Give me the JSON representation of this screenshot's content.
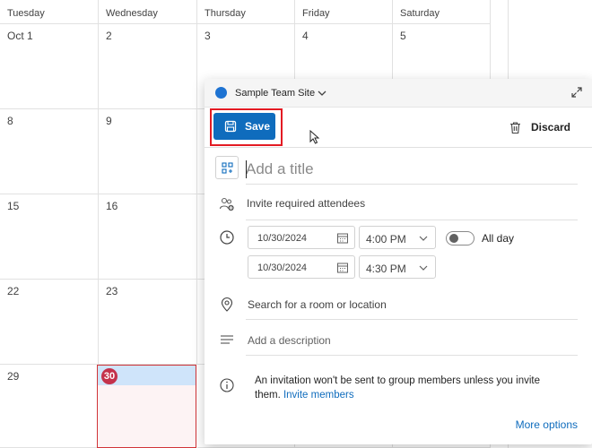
{
  "calendar": {
    "day_headers": [
      "Tuesday",
      "Wednesday",
      "Thursday",
      "Friday",
      "Saturday"
    ],
    "weeks": [
      [
        "Oct 1",
        "2",
        "3",
        "4",
        "5"
      ],
      [
        "8",
        "9",
        "",
        "",
        ""
      ],
      [
        "15",
        "16",
        "",
        "",
        ""
      ],
      [
        "22",
        "23",
        "",
        "",
        ""
      ],
      [
        "29",
        "30",
        "",
        "",
        ""
      ]
    ],
    "today": "30"
  },
  "popup": {
    "calendar_name": "Sample Team Site",
    "save_label": "Save",
    "discard_label": "Discard",
    "title_placeholder": "Add a title",
    "attendees_placeholder": "Invite required attendees",
    "start_date": "10/30/2024",
    "start_time": "4:00 PM",
    "end_date": "10/30/2024",
    "end_time": "4:30 PM",
    "all_day_label": "All day",
    "location_placeholder": "Search for a room or location",
    "description_placeholder": "Add a description",
    "info_text": "An invitation won't be sent to group members unless you invite them.",
    "invite_link": "Invite members",
    "more_options": "More options"
  },
  "colors": {
    "accent": "#0f6cbd",
    "today_badge": "#c4314b",
    "highlight_outline": "#e31b23"
  }
}
